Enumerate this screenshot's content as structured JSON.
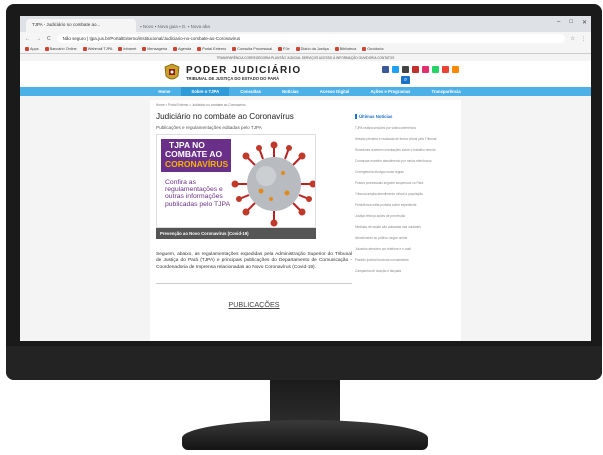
{
  "browser": {
    "tab_title": "TJPA - Judiciário no combate ao...",
    "other_tabs": "▪ Novo  ▪ Nova guia  ▪ G.  ▪ Nova aba",
    "window_controls": [
      "–",
      "□",
      "✕"
    ],
    "nav_back": "←",
    "nav_forward": "→",
    "nav_reload": "C",
    "url": "Não seguro | tjpa.jus.br/PortalExterno/institucional/Judiciario-no-combate-ao-Coronavirus",
    "bookmarks": [
      "Apps",
      "Bancário Online",
      "Webmail TJPA",
      "Intranet",
      "Mensageria",
      "Agenda",
      "Portal Externo",
      "Consulta Processual",
      "PJe",
      "Diário da Justiça",
      "Biblioteca",
      "Ouvidoria"
    ]
  },
  "site": {
    "top_links": "TRANSPARÊNCIA  CORREGEDORIA  PLANTÃO JUDICIAL  SERVIÇOS  ACESSO À INFORMAÇÃO  OUVIDORIA  CONTATOS",
    "brand_title": "PODER JUDICIÁRIO",
    "brand_subtitle": "TRIBUNAL DE JUSTIÇA DO ESTADO DO PARÁ",
    "brand_date": "",
    "search_icon_glyph": "⌕",
    "social_colors": [
      "#3b5998",
      "#1da1f2",
      "#444444",
      "#c4302b",
      "#e1306c",
      "#25d366",
      "#ea4335",
      "#ff8800"
    ],
    "main_nav": [
      "Home",
      "Sobre o TJPA",
      "Consultas",
      "Notícias",
      "Acesso Digital",
      "Ações e Programas",
      "Transparência"
    ],
    "breadcrumb": "Home > Portal Externo > Judiciário no combate ao Coronavírus",
    "page_title": "Judiciário no combate ao Coronavírus",
    "page_subtitle": "Publicações e regulamentações editadas pelo TJPA",
    "banner": {
      "line1": "TJPA NO",
      "line2": "COMBATE AO",
      "line3": "CORONAVÍRUS",
      "body": "Confira as regulamentações e outras informações publicadas pelo TJPA"
    },
    "caption": "Prevenção ao Novo Coronavírus (Covid-19)",
    "paragraph": "Seguem, abaixo, as regulamentações expedidas pela Administração Superior do Tribunal de Justiça do Pará (TJPA) e principais publicações do Departamento de Comunicação - Coordenadoria de Imprensa relacionadas ao Novo Coronavírus (Covid-19).",
    "publications_heading": "PUBLICAÇÕES",
    "sidebar_heading": "Últimas Notícias",
    "sidebar_items": [
      "TJPA realiza sessões por videoconferência",
      "Sessão plenária é realizada de forma virtual pelo Tribunal",
      "Servidores recebem orientações sobre o trabalho remoto",
      "Comarcas mantêm atendimento por meios eletrônicos",
      "Corregedoria divulga novas regras",
      "Prazos processuais seguem suspensos no Pará",
      "Tribunal amplia atendimento virtual à população",
      "Presidência edita portaria sobre expediente",
      "Justiça reforça ações de prevenção",
      "Medidas de saúde são adotadas nas unidades",
      "Atendimento ao público segue online",
      "Juizados atendem por telefone e e-mail",
      "Plantão judicial funciona normalmente",
      "Campanha de doação é lançada"
    ]
  }
}
